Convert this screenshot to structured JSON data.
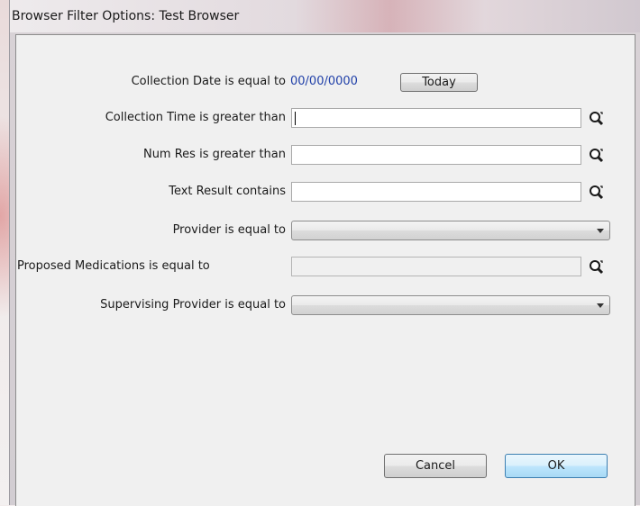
{
  "window": {
    "title": "Browser Filter Options: Test Browser"
  },
  "filters": {
    "collection_date": {
      "label": "Collection Date is equal to",
      "value": "00/00/0000",
      "today_label": "Today"
    },
    "collection_time": {
      "label": "Collection Time is greater than",
      "value": ""
    },
    "num_res": {
      "label": "Num Res is greater than",
      "value": ""
    },
    "text_result": {
      "label": "Text Result contains",
      "value": ""
    },
    "provider": {
      "label": "Provider is equal to",
      "value": ""
    },
    "proposed_medications": {
      "label": "Proposed Medications is equal to",
      "value": ""
    },
    "supervising_provider": {
      "label": "Supervising Provider is equal to",
      "value": ""
    }
  },
  "footer": {
    "cancel_label": "Cancel",
    "ok_label": "OK"
  },
  "icons": {
    "lookup": "magnifier-lookup-icon",
    "dropdown": "chevron-down-icon"
  },
  "colors": {
    "date_text": "#1f3fa8",
    "default_button": "#3c7fb1"
  }
}
